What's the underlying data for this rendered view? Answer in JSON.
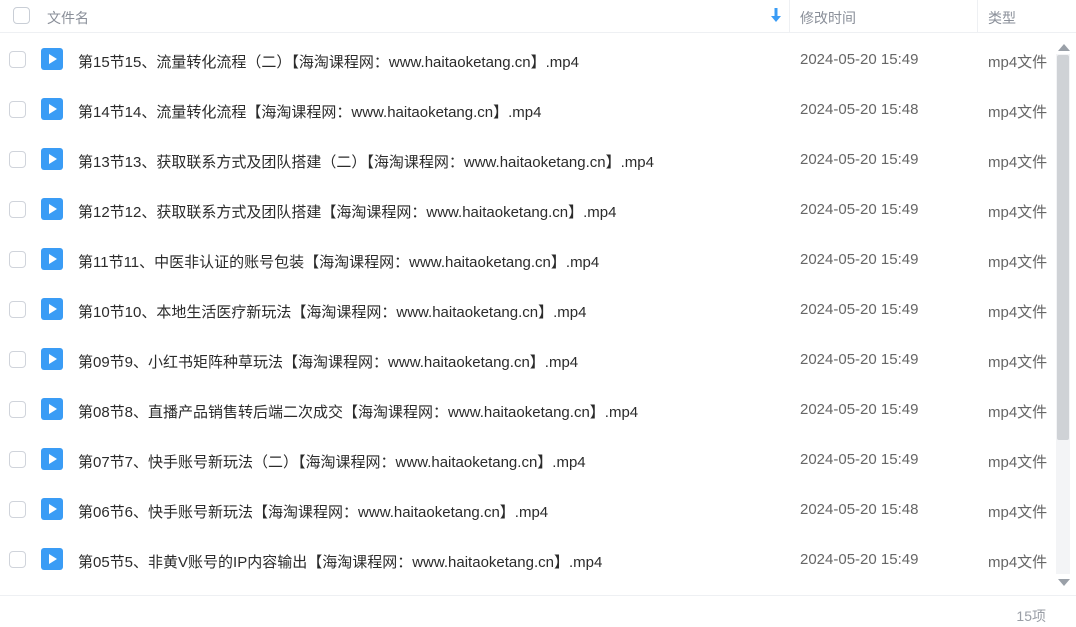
{
  "header": {
    "name_label": "文件名",
    "time_label": "修改时间",
    "type_label": "类型"
  },
  "colors": {
    "accent": "#3a9cf5",
    "icon_bg": "#3a9cf5"
  },
  "files": [
    {
      "name": "第15节15、流量转化流程（二）【海淘课程网：www.haitaoketang.cn】.mp4",
      "time": "2024-05-20 15:49",
      "type": "mp4文件",
      "icon": "video-file-icon"
    },
    {
      "name": "第14节14、流量转化流程【海淘课程网：www.haitaoketang.cn】.mp4",
      "time": "2024-05-20 15:48",
      "type": "mp4文件",
      "icon": "video-file-icon"
    },
    {
      "name": "第13节13、获取联系方式及团队搭建（二）【海淘课程网：www.haitaoketang.cn】.mp4",
      "time": "2024-05-20 15:49",
      "type": "mp4文件",
      "icon": "video-file-icon"
    },
    {
      "name": "第12节12、获取联系方式及团队搭建【海淘课程网：www.haitaoketang.cn】.mp4",
      "time": "2024-05-20 15:49",
      "type": "mp4文件",
      "icon": "video-file-icon"
    },
    {
      "name": "第11节11、中医非认证的账号包装【海淘课程网：www.haitaoketang.cn】.mp4",
      "time": "2024-05-20 15:49",
      "type": "mp4文件",
      "icon": "video-file-icon"
    },
    {
      "name": "第10节10、本地生活医疗新玩法【海淘课程网：www.haitaoketang.cn】.mp4",
      "time": "2024-05-20 15:49",
      "type": "mp4文件",
      "icon": "video-file-icon"
    },
    {
      "name": "第09节9、小红书矩阵种草玩法【海淘课程网：www.haitaoketang.cn】.mp4",
      "time": "2024-05-20 15:49",
      "type": "mp4文件",
      "icon": "video-file-icon"
    },
    {
      "name": "第08节8、直播产品销售转后端二次成交【海淘课程网：www.haitaoketang.cn】.mp4",
      "time": "2024-05-20 15:49",
      "type": "mp4文件",
      "icon": "video-file-icon"
    },
    {
      "name": "第07节7、快手账号新玩法（二）【海淘课程网：www.haitaoketang.cn】.mp4",
      "time": "2024-05-20 15:49",
      "type": "mp4文件",
      "icon": "video-file-icon"
    },
    {
      "name": "第06节6、快手账号新玩法【海淘课程网：www.haitaoketang.cn】.mp4",
      "time": "2024-05-20 15:48",
      "type": "mp4文件",
      "icon": "video-file-icon"
    },
    {
      "name": "第05节5、非黄V账号的IP内容输出【海淘课程网：www.haitaoketang.cn】.mp4",
      "time": "2024-05-20 15:49",
      "type": "mp4文件",
      "icon": "video-file-icon"
    }
  ],
  "footer": {
    "count_label": "15项"
  }
}
